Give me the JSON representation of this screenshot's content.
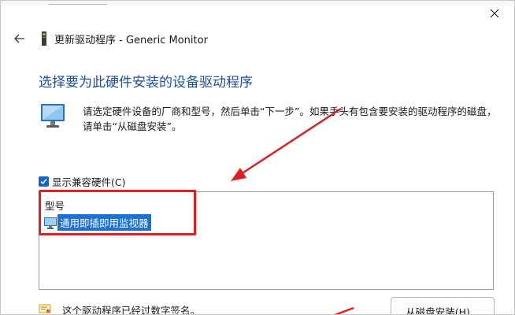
{
  "window": {
    "title": "更新驱动程序 - Generic Monitor"
  },
  "page": {
    "heading": "选择要为此硬件安装的设备驱动程序",
    "description_line1": "请选定硬件设备的厂商和型号，然后单击“下一步”。如果手头有包含要安装的驱动程序的磁盘，",
    "description_line2": "请单击“从磁盘安装”。"
  },
  "compatible": {
    "label": "显示兼容硬件(C)",
    "checked": true
  },
  "model_list": {
    "header": "型号",
    "items": [
      {
        "label": "通用即插即用监视器",
        "selected": true
      }
    ]
  },
  "footer": {
    "signed_text": "这个驱动程序已经过数字签名。",
    "have_disk_label": "从磁盘安装(H)..."
  },
  "colors": {
    "heading": "#1b4f9e",
    "selection": "#1a73d4",
    "checkbox": "#1466c4",
    "annotation": "#e02020"
  },
  "icons": {
    "close": "close-icon",
    "back": "back-arrow-icon",
    "device": "device-icon",
    "monitor": "monitor-icon",
    "list_item": "monitor-small-icon",
    "signed": "certificate-icon",
    "checkbox": "checkmark-icon"
  }
}
